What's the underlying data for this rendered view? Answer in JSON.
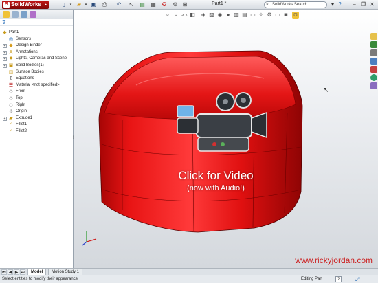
{
  "app": {
    "name": "SolidWorks",
    "document_title": "Part1 *"
  },
  "search": {
    "placeholder": "SolidWorks Search"
  },
  "feature_tree": {
    "root": "Part1",
    "items": [
      {
        "label": "Sensors",
        "icon": "sensor-icon",
        "expandable": false
      },
      {
        "label": "Design Binder",
        "icon": "binder-icon",
        "expandable": true
      },
      {
        "label": "Annotations",
        "icon": "annotations-icon",
        "expandable": true
      },
      {
        "label": "Lights, Cameras and Scene",
        "icon": "lights-icon",
        "expandable": true
      },
      {
        "label": "Solid Bodies(1)",
        "icon": "solid-bodies-icon",
        "expandable": true
      },
      {
        "label": "Surface Bodies",
        "icon": "surface-bodies-icon",
        "expandable": false
      },
      {
        "label": "Equations",
        "icon": "equations-icon",
        "expandable": false
      },
      {
        "label": "Material <not specified>",
        "icon": "material-icon",
        "expandable": false
      },
      {
        "label": "Front",
        "icon": "plane-icon",
        "expandable": false
      },
      {
        "label": "Top",
        "icon": "plane-icon",
        "expandable": false
      },
      {
        "label": "Right",
        "icon": "plane-icon",
        "expandable": false
      },
      {
        "label": "Origin",
        "icon": "origin-icon",
        "expandable": false
      },
      {
        "label": "Extrude1",
        "icon": "extrude-icon",
        "expandable": true
      },
      {
        "label": "Fillet1",
        "icon": "fillet-icon",
        "expandable": false
      },
      {
        "label": "Fillet2",
        "icon": "fillet-icon",
        "expandable": false
      }
    ]
  },
  "overlay": {
    "title": "Click for Video",
    "subtitle": "(now with Audio!)"
  },
  "watermark": "www.rickyjordan.com",
  "tabs": [
    {
      "label": "Model",
      "active": true
    },
    {
      "label": "Motion Study 1"
    }
  ],
  "status": {
    "message": "Select entities to modify their appearance",
    "mode": "Editing Part",
    "help": "?"
  },
  "colors": {
    "part": "#e01010",
    "brand": "#b31010",
    "accent": "#2a6fb8",
    "watermark": "#cc2020"
  }
}
